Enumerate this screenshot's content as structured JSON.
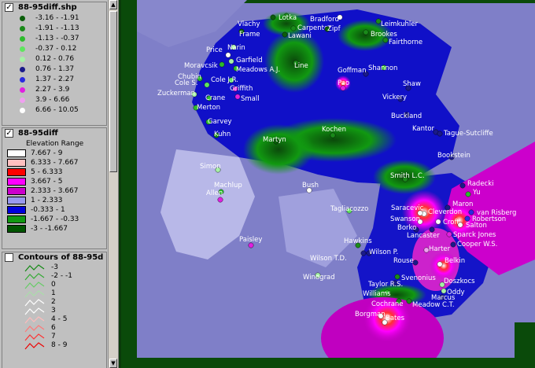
{
  "legend": {
    "points_theme": {
      "title": "88-95diff.shp",
      "checked": true,
      "classes": [
        {
          "label": "-3.16 - -1.91",
          "color": "#0b5e0b"
        },
        {
          "label": "-1.91 - -1.13",
          "color": "#1a8a1a"
        },
        {
          "label": "-1.13 - -0.37",
          "color": "#2dbb2d"
        },
        {
          "label": "-0.37 - 0.12",
          "color": "#5fe55f"
        },
        {
          "label": "0.12 - 0.76",
          "color": "#a7f0a7"
        },
        {
          "label": "0.76 - 1.37",
          "color": "#1a1a8a"
        },
        {
          "label": "1.37 - 2.27",
          "color": "#2a2ae0"
        },
        {
          "label": "2.27 - 3.9",
          "color": "#e020e0"
        },
        {
          "label": "3.9 - 6.66",
          "color": "#f0a0f0"
        },
        {
          "label": "6.66 - 10.05",
          "color": "#ffffff"
        }
      ]
    },
    "elevation_theme": {
      "title": "88-95diff",
      "checked": true,
      "subtitle": "Elevation Range",
      "classes": [
        {
          "label": "7.667 - 9",
          "color": "#ffffff"
        },
        {
          "label": "6.333 - 7.667",
          "color": "#ffc0c0"
        },
        {
          "label": "5 - 6.333",
          "color": "#ff0000"
        },
        {
          "label": "3.667 - 5",
          "color": "#ff00ff"
        },
        {
          "label": "2.333 - 3.667",
          "color": "#cc00cc"
        },
        {
          "label": "1 - 2.333",
          "color": "#9999ee"
        },
        {
          "label": "-0.333 - 1",
          "color": "#0000dd"
        },
        {
          "label": "-1.667 - -0.33",
          "color": "#119911"
        },
        {
          "label": "-3 - -1.667",
          "color": "#005500"
        }
      ]
    },
    "contours_theme": {
      "title": "Contours of 88-95d",
      "checked": false,
      "classes": [
        {
          "label": "-3",
          "color": "#118811"
        },
        {
          "label": "-2 - -1",
          "color": "#33aa33"
        },
        {
          "label": "0",
          "color": "#66cc66"
        },
        {
          "label": "1",
          "color": "#aaddaa"
        },
        {
          "label": "2",
          "color": "#ffffff"
        },
        {
          "label": "3",
          "color": "#ffffff"
        },
        {
          "label": "4 - 5",
          "color": "#ffbbbb"
        },
        {
          "label": "6",
          "color": "#ff7777"
        },
        {
          "label": "7",
          "color": "#ff3333"
        },
        {
          "label": "8 - 9",
          "color": "#ee0000"
        }
      ]
    }
  },
  "map_points": [
    {
      "name": "Vlachy",
      "color": "#0b5e0b"
    },
    {
      "name": "Lotka",
      "color": "#1a8a1a"
    },
    {
      "name": "Bradford",
      "color": "#ffffff"
    },
    {
      "name": "Leimkuhler",
      "color": "#1a8a1a"
    },
    {
      "name": "Carpenter",
      "color": "#1a8a1a"
    },
    {
      "name": "Lawani",
      "color": "#0b5e0b"
    },
    {
      "name": "Frame",
      "color": "#0b5e0b"
    },
    {
      "name": "Zipf",
      "color": "#0b5e0b"
    },
    {
      "name": "Brookes",
      "color": "#1a8a1a"
    },
    {
      "name": "Fairthorne",
      "color": "#1a8a1a"
    },
    {
      "name": "Price",
      "color": "#ffffff"
    },
    {
      "name": "Narin",
      "color": "#a7f0a7"
    },
    {
      "name": "Garfield",
      "color": "#a7f0a7"
    },
    {
      "name": "Meadows A.J.",
      "color": "#2dbb2d"
    },
    {
      "name": "Moravcsik",
      "color": "#2dbb2d"
    },
    {
      "name": "Line",
      "color": "#1a8a1a"
    },
    {
      "name": "Goffman",
      "color": "#1a1a8a"
    },
    {
      "name": "Shannon",
      "color": "#2dbb2d"
    },
    {
      "name": "Chubin",
      "color": "#2dbb2d"
    },
    {
      "name": "Cole S.",
      "color": "#5fe55f"
    },
    {
      "name": "Cole J.R.",
      "color": "#5fe55f"
    },
    {
      "name": "Griffith",
      "color": "#e020e0"
    },
    {
      "name": "Zuckerman",
      "color": "#a7f0a7"
    },
    {
      "name": "Crane",
      "color": "#2dbb2d"
    },
    {
      "name": "Small",
      "color": "#e020e0"
    },
    {
      "name": "Pao",
      "color": "#e020e0"
    },
    {
      "name": "Shaw",
      "color": "#1a1a8a"
    },
    {
      "name": "Vickery",
      "color": "#1a1a8a"
    },
    {
      "name": "Merton",
      "color": "#2dbb2d"
    },
    {
      "name": "Buckland",
      "color": "#1a1a8a"
    },
    {
      "name": "Garvey",
      "color": "#2dbb2d"
    },
    {
      "name": "Kuhn",
      "color": "#1a8a1a"
    },
    {
      "name": "Kochen",
      "color": "#1a8a1a"
    },
    {
      "name": "Kantor",
      "color": "#1a1a8a"
    },
    {
      "name": "Tague-Sutcliffe",
      "color": "#1a1a8a"
    },
    {
      "name": "Martyn",
      "color": "#0b5e0b"
    },
    {
      "name": "Bookstein",
      "color": "#1a1a8a"
    },
    {
      "name": "Simon",
      "color": "#a7f0a7"
    },
    {
      "name": "Smith L.C.",
      "color": "#1a8a1a"
    },
    {
      "name": "Radecki",
      "color": "#1a1a8a"
    },
    {
      "name": "Machlup",
      "color": "#2dbb2d"
    },
    {
      "name": "Bush",
      "color": "#ffffff"
    },
    {
      "name": "Yu",
      "color": "#2dbb2d"
    },
    {
      "name": "Allen",
      "color": "#e020e0"
    },
    {
      "name": "Maron",
      "color": "#1a1a8a"
    },
    {
      "name": "Saracevic",
      "color": "#ffffff"
    },
    {
      "name": "Cleverdon",
      "color": "#ffffff"
    },
    {
      "name": "Tagliacozzo",
      "color": "#5fe55f"
    },
    {
      "name": "van Risberg",
      "color": "#2a2ae0"
    },
    {
      "name": "Croft",
      "color": "#ffffff"
    },
    {
      "name": "Robertson",
      "color": "#2a2ae0"
    },
    {
      "name": "Swanson",
      "color": "#ffffff"
    },
    {
      "name": "Salton",
      "color": "#ffffff"
    },
    {
      "name": "Borko",
      "color": "#1a1a8a"
    },
    {
      "name": "Lancaster",
      "color": "#1a1a8a"
    },
    {
      "name": "Sparck Jones",
      "color": "#e020e0"
    },
    {
      "name": "Paisley",
      "color": "#e020e0"
    },
    {
      "name": "Hawkins",
      "color": "#1a8a1a"
    },
    {
      "name": "Cooper W.S.",
      "color": "#1a1a8a"
    },
    {
      "name": "Harter",
      "color": "#f0a0f0"
    },
    {
      "name": "Wilson P.",
      "color": "#1a1a8a"
    },
    {
      "name": "Wilson T.D.",
      "color": "#1a1a8a"
    },
    {
      "name": "Rouse",
      "color": "#1a1a8a"
    },
    {
      "name": "Belkin",
      "color": "#ffffff"
    },
    {
      "name": "Winograd",
      "color": "#a7f0a7"
    },
    {
      "name": "Svenonius",
      "color": "#1a8a1a"
    },
    {
      "name": "Doszkocs",
      "color": "#a7f0a7"
    },
    {
      "name": "Taylor R.S.",
      "color": "#1a1a8a"
    },
    {
      "name": "Oddy",
      "color": "#a7f0a7"
    },
    {
      "name": "Williams",
      "color": "#2dbb2d"
    },
    {
      "name": "Marcus",
      "color": "#1a1a8a"
    },
    {
      "name": "Cochrane",
      "color": "#1a8a1a"
    },
    {
      "name": "Meadow C.T.",
      "color": "#1a8a1a"
    },
    {
      "name": "Borgman",
      "color": "#ffffff"
    },
    {
      "name": "Bates",
      "color": "#ffffff"
    }
  ]
}
